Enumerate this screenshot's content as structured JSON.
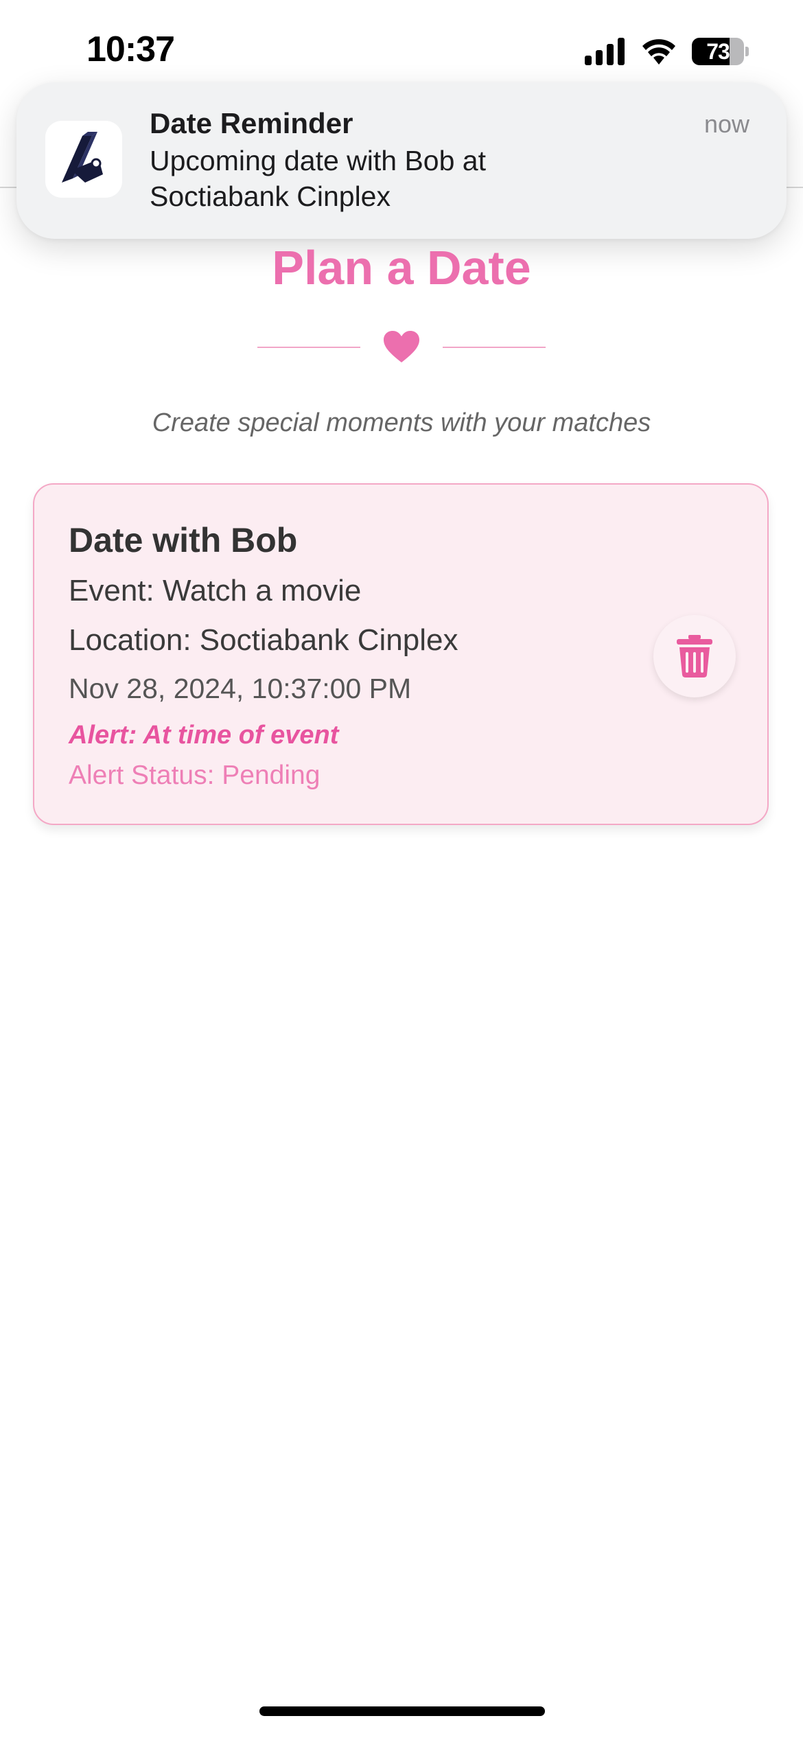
{
  "status_bar": {
    "time": "10:37",
    "battery_level": "73",
    "battery_fraction": 0.73,
    "icons": [
      "signal-icon",
      "wifi-icon",
      "battery-icon"
    ]
  },
  "notification": {
    "app_icon": "app-logo-icon",
    "title": "Date Reminder",
    "body": "Upcoming date with Bob at Soctiabank Cinplex",
    "time": "now"
  },
  "page": {
    "title": "Plan a Date",
    "divider_icon": "heart-icon",
    "subtitle": "Create special moments with your matches"
  },
  "dates": [
    {
      "title": "Date with Bob",
      "event": "Event: Watch a movie",
      "location": "Location: Soctiabank Cinplex",
      "datetime": "Nov 28, 2024, 10:37:00 PM",
      "alert": "Alert: At time of event",
      "alert_status": "Alert Status: Pending",
      "delete_icon": "trash-icon"
    }
  ],
  "colors": {
    "accent_pink": "#ec6fae",
    "card_background": "#fcedf2",
    "card_border": "#f4a8c6",
    "alert_pink": "#e8549f"
  }
}
